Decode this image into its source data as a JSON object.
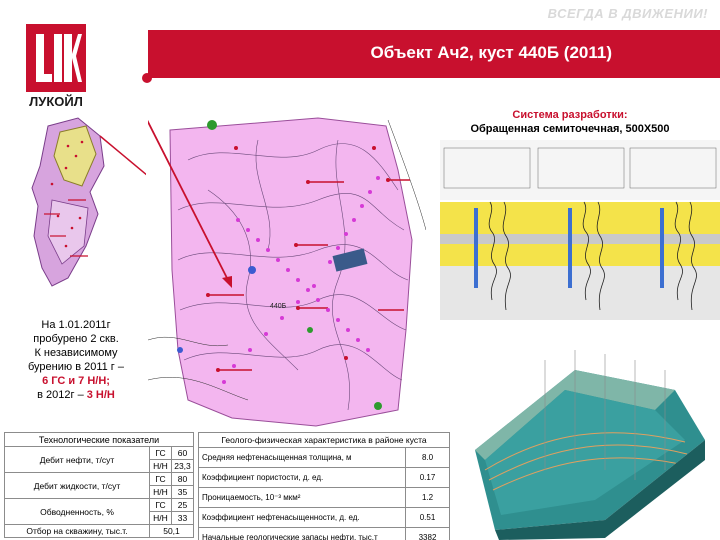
{
  "header": {
    "slogan": "ВСЕГДА В ДВИЖЕНИИ!",
    "title": "Объект Ач2, куст 440Б (2011)",
    "logo_text": "ЛУКОЙЛ"
  },
  "system": {
    "line1": "Система разработки:",
    "line2": "Обращенная семиточечная, 500X500"
  },
  "map": {
    "cluster_label": "440Б"
  },
  "drilled": {
    "line1": "На 1.01.2011г",
    "line2": "пробурено 2 скв.",
    "line3": "К независимому",
    "line4": "бурению в 2011 г –",
    "line5": "6 ГС и 7 Н/Н;",
    "line6": "в 2012г – ",
    "line6_hl": "3 Н/Н"
  },
  "tech_table": {
    "header": "Технологические показатели",
    "rows": [
      {
        "label": "Дебит нефти, т/сут",
        "gs_type": "ГС",
        "gs_val": "60",
        "nn_type": "Н/Н",
        "nn_val": "23,3"
      },
      {
        "label": "Дебит жидкости, т/сут",
        "gs_type": "ГС",
        "gs_val": "80",
        "nn_type": "Н/Н",
        "nn_val": "35"
      },
      {
        "label": "Обводненность, %",
        "gs_type": "ГС",
        "gs_val": "25",
        "nn_type": "Н/Н",
        "nn_val": "33"
      }
    ],
    "last_label": "Отбор на скважину, тыс.т.",
    "last_value": "50,1"
  },
  "geo_table": {
    "header": "Геолого-физическая характеристика в районе куста",
    "rows": [
      {
        "label": "Средняя нефтенасыщенная толщина, м",
        "value": "8.0"
      },
      {
        "label": "Коэффициент пористости, д. ед.",
        "value": "0.17"
      },
      {
        "label": "Проницаемость, 10⁻³ мкм²",
        "value": "1.2"
      },
      {
        "label": "Коэффициент нефтенасыщенности, д. ед.",
        "value": "0.51"
      },
      {
        "label": "Начальные геологические запасы нефти, тыс.т",
        "value": "3382"
      }
    ]
  }
}
